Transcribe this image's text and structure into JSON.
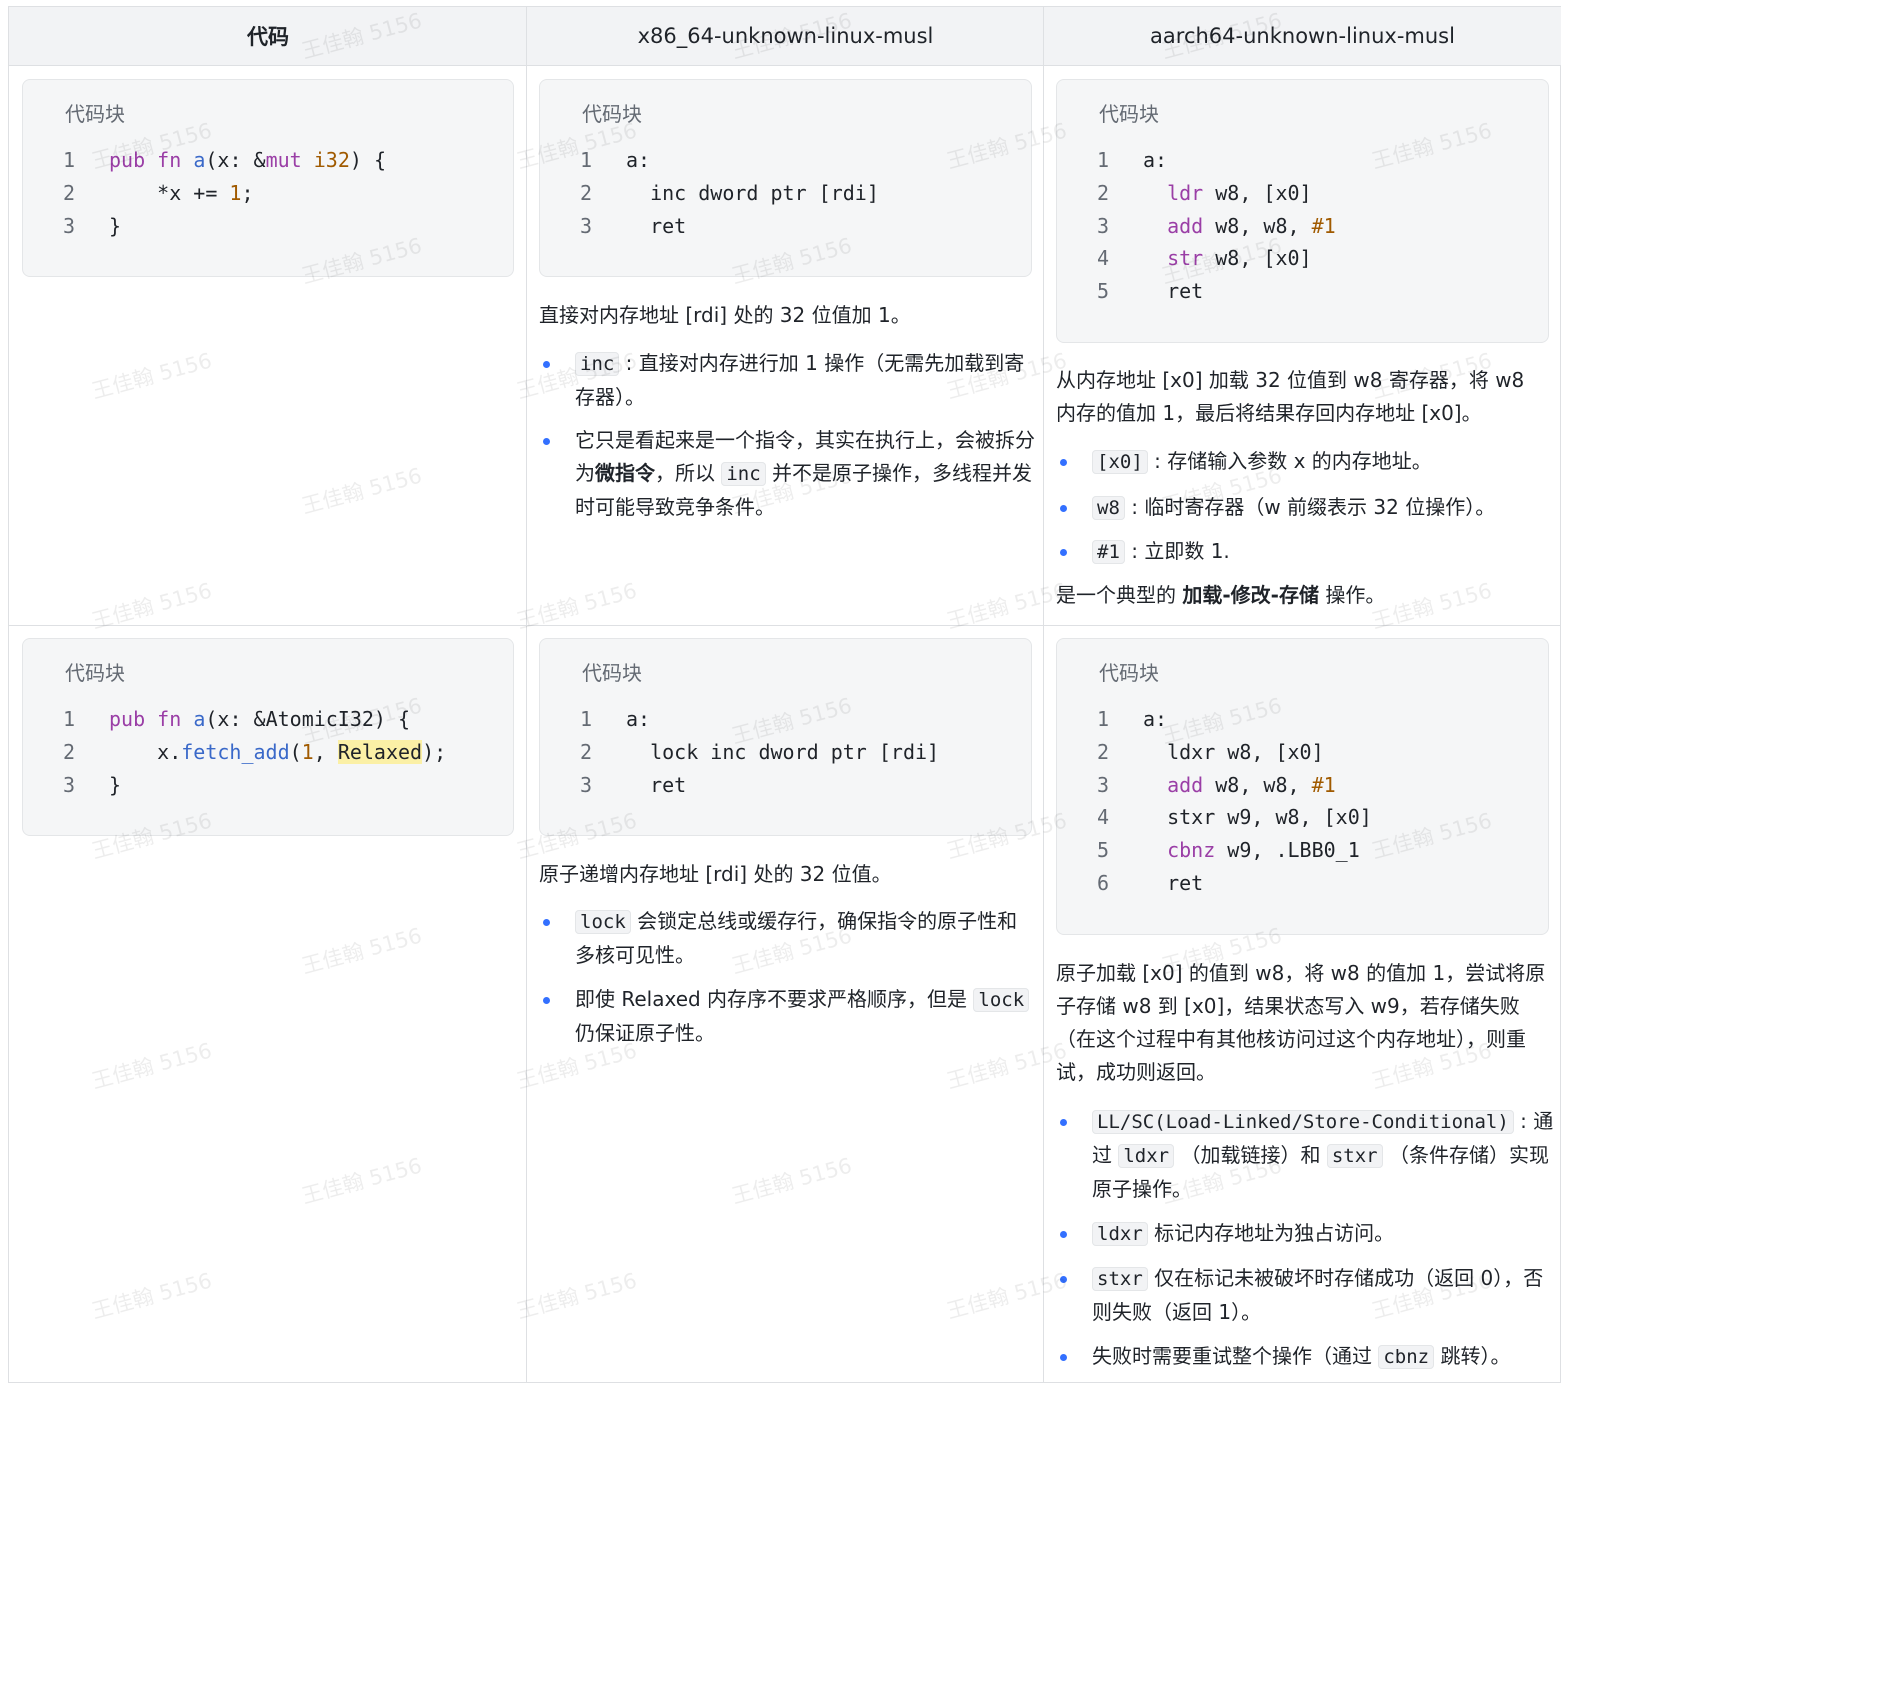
{
  "header": {
    "col1": "代码",
    "col2": "x86_64-unknown-linux-musl",
    "col3": "aarch64-unknown-linux-musl"
  },
  "code_block_title": "代码块",
  "watermark": "王佳翰 5156",
  "rows": [
    {
      "rust": {
        "line_numbers": [
          "1",
          "2",
          "3"
        ],
        "lines": [
          [
            {
              "t": "pub",
              "c": "kw"
            },
            {
              "t": " "
            },
            {
              "t": "fn",
              "c": "kw"
            },
            {
              "t": " "
            },
            {
              "t": "a",
              "c": "fn"
            },
            {
              "t": "(x: &"
            },
            {
              "t": "mut",
              "c": "kw"
            },
            {
              "t": " "
            },
            {
              "t": "i32",
              "c": "ty"
            },
            {
              "t": ") {"
            }
          ],
          [
            {
              "t": "    *x += "
            },
            {
              "t": "1",
              "c": "num"
            },
            {
              "t": ";"
            }
          ],
          [
            {
              "t": "}"
            }
          ]
        ]
      },
      "x86": {
        "line_numbers": [
          "1",
          "2",
          "3"
        ],
        "lines": [
          [
            {
              "t": "a:"
            }
          ],
          [
            {
              "t": "  inc dword ptr [rdi]"
            }
          ],
          [
            {
              "t": "  ret"
            }
          ]
        ],
        "description": "直接对内存地址 [rdi] 处的 32 位值加 1。",
        "bullets": [
          [
            {
              "code": "inc"
            },
            {
              "t": " : 直接对内存进行加 1 操作（无需先加载到寄存器）。"
            }
          ],
          [
            {
              "t": "它只是看起来是一个指令，其实在执行上，会被拆分为"
            },
            {
              "b": "微指令"
            },
            {
              "t": "，所以 "
            },
            {
              "code": "inc"
            },
            {
              "t": " 并不是原子操作，多线程并发时可能导致竞争条件。"
            }
          ]
        ]
      },
      "arm": {
        "line_numbers": [
          "1",
          "2",
          "3",
          "4",
          "5"
        ],
        "lines": [
          [
            {
              "t": "a:"
            }
          ],
          [
            {
              "t": "  "
            },
            {
              "t": "ldr",
              "c": "kw"
            },
            {
              "t": " w8, [x0]"
            }
          ],
          [
            {
              "t": "  "
            },
            {
              "t": "add",
              "c": "kw"
            },
            {
              "t": " w8, w8, "
            },
            {
              "t": "#1",
              "c": "num"
            }
          ],
          [
            {
              "t": "  "
            },
            {
              "t": "str",
              "c": "kw"
            },
            {
              "t": " w8, [x0]"
            }
          ],
          [
            {
              "t": "  ret"
            }
          ]
        ],
        "description": "从内存地址 [x0] 加载 32 位值到 w8 寄存器，将 w8 内存的值加 1，最后将结果存回内存地址 [x0]。",
        "bullets": [
          [
            {
              "code": "[x0]"
            },
            {
              "t": " : 存储输入参数 x 的内存地址。"
            }
          ],
          [
            {
              "code": "w8"
            },
            {
              "t": " : 临时寄存器（w 前缀表示 32 位操作）。"
            }
          ],
          [
            {
              "code": "#1"
            },
            {
              "t": " : 立即数 1."
            }
          ]
        ],
        "footer": [
          {
            "t": "是一个典型的 "
          },
          {
            "b": "加载-修改-存储"
          },
          {
            "t": " 操作。"
          }
        ]
      }
    },
    {
      "rust": {
        "line_numbers": [
          "1",
          "2",
          "3"
        ],
        "lines": [
          [
            {
              "t": "pub",
              "c": "kw"
            },
            {
              "t": " "
            },
            {
              "t": "fn",
              "c": "kw"
            },
            {
              "t": " "
            },
            {
              "t": "a",
              "c": "fn"
            },
            {
              "t": "(x: &AtomicI32) {"
            }
          ],
          [
            {
              "t": "    x."
            },
            {
              "t": "fetch_add",
              "c": "fn"
            },
            {
              "t": "("
            },
            {
              "t": "1",
              "c": "num"
            },
            {
              "t": ", "
            },
            {
              "t": "Relaxed",
              "c": "hl"
            },
            {
              "t": ");"
            }
          ],
          [
            {
              "t": "}"
            }
          ]
        ]
      },
      "x86": {
        "line_numbers": [
          "1",
          "2",
          "3"
        ],
        "lines": [
          [
            {
              "t": "a:"
            }
          ],
          [
            {
              "t": "  lock inc dword ptr [rdi]"
            }
          ],
          [
            {
              "t": "  ret"
            }
          ]
        ],
        "description": "原子递增内存地址 [rdi] 处的 32 位值。",
        "bullets": [
          [
            {
              "code": "lock"
            },
            {
              "t": " 会锁定总线或缓存行，确保指令的原子性和多核可见性。"
            }
          ],
          [
            {
              "t": "即使 Relaxed 内存序不要求严格顺序，但是 "
            },
            {
              "code": "lock"
            },
            {
              "t": " 仍保证原子性。"
            }
          ]
        ]
      },
      "arm": {
        "line_numbers": [
          "1",
          "2",
          "3",
          "4",
          "5",
          "6"
        ],
        "lines": [
          [
            {
              "t": "a:"
            }
          ],
          [
            {
              "t": "  ldxr w8, [x0]"
            }
          ],
          [
            {
              "t": "  "
            },
            {
              "t": "add",
              "c": "kw"
            },
            {
              "t": " w8, w8, "
            },
            {
              "t": "#1",
              "c": "num"
            }
          ],
          [
            {
              "t": "  stxr w9, w8, [x0]"
            }
          ],
          [
            {
              "t": "  "
            },
            {
              "t": "cbnz",
              "c": "kw"
            },
            {
              "t": " w9, .LBB0_1"
            }
          ],
          [
            {
              "t": "  ret"
            }
          ]
        ],
        "description": "原子加载 [x0] 的值到 w8，将 w8 的值加 1，尝试将原子存储 w8 到 [x0]，结果状态写入 w9，若存储失败（在这个过程中有其他核访问过这个内存地址），则重试，成功则返回。",
        "bullets": [
          [
            {
              "code": "LL/SC(Load-Linked/Store-Conditional)"
            },
            {
              "t": " : 通过 "
            },
            {
              "code": "ldxr"
            },
            {
              "t": " （加载链接）和 "
            },
            {
              "code": "stxr"
            },
            {
              "t": " （条件存储）实现原子操作。"
            }
          ],
          [
            {
              "code": "ldxr"
            },
            {
              "t": " 标记内存地址为独占访问。"
            }
          ],
          [
            {
              "code": "stxr"
            },
            {
              "t": " 仅在标记未被破坏时存储成功（返回 0），否则失败（返回 1）。"
            }
          ],
          [
            {
              "t": "失败时需要重试整个操作（通过 "
            },
            {
              "code": "cbnz"
            },
            {
              "t": " 跳转）。"
            }
          ]
        ]
      }
    }
  ]
}
